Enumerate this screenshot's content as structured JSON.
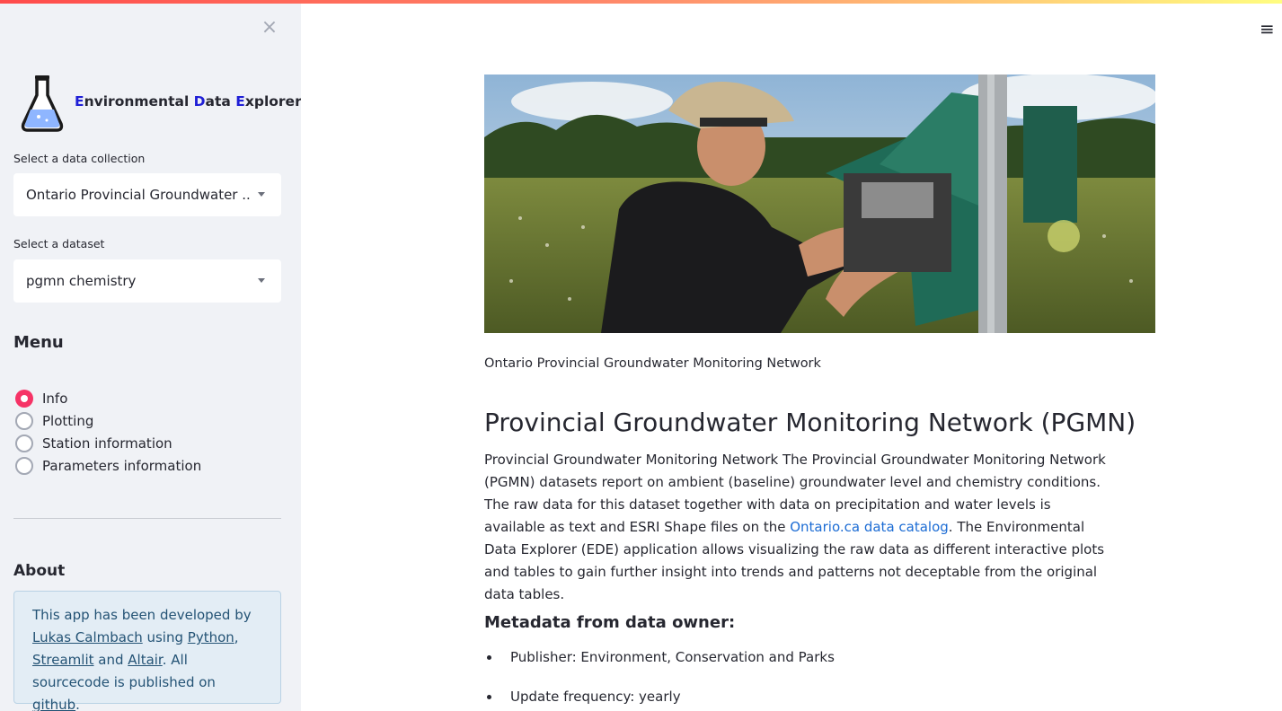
{
  "app": {
    "title_parts": [
      "E",
      "nvironmental ",
      "D",
      "ata ",
      "E",
      "xplorer"
    ]
  },
  "sidebar": {
    "close_glyph": "×",
    "collection_label": "Select a data collection",
    "collection_value": "Ontario Provincial Groundwater ...",
    "dataset_label": "Select a dataset",
    "dataset_value": "pgmn chemistry",
    "menu_heading": "Menu",
    "menu_items": [
      {
        "label": "Info",
        "selected": true
      },
      {
        "label": "Plotting",
        "selected": false
      },
      {
        "label": "Station information",
        "selected": false
      },
      {
        "label": "Parameters information",
        "selected": false
      }
    ],
    "about_heading": "About",
    "about": {
      "t1": "This app has been developed by ",
      "link1": "Lukas Calmbach",
      "t2": " using ",
      "link2": "Python",
      "t3": ", ",
      "link3": "Streamlit",
      "t4": " and ",
      "link4": "Altair",
      "t5": ". All sourcecode is published on ",
      "link5": "github",
      "t6": "."
    }
  },
  "main": {
    "menu_glyph": "≡",
    "hero_alt": "",
    "caption": "Ontario Provincial Groundwater Monitoring Network",
    "heading": "Provincial Groundwater Monitoring Network (PGMN)",
    "para_before": "Provincial Groundwater Monitoring Network The Provincial Groundwater Monitoring Network (PGMN) datasets report on ambient (baseline) groundwater level and chemistry conditions. The raw data for this dataset together with data on precipitation and water levels is available as text and ESRI Shape files on the ",
    "para_link": "Ontario.ca data catalog",
    "para_after": ". The Environmental Data Explorer (EDE) application allows visualizing the raw data as different interactive plots and tables to gain further insight into trends and patterns not deceptable from the original data tables.",
    "metadata_heading": "Metadata from data owner:",
    "metadata_items": [
      "Publisher: Environment, Conservation and Parks",
      "Update frequency: yearly"
    ]
  },
  "colors": {
    "accent": "#f63366",
    "logo_highlight": "#1f1fd6",
    "link": "#1c6cd4",
    "info_box": "#e3edf5"
  }
}
